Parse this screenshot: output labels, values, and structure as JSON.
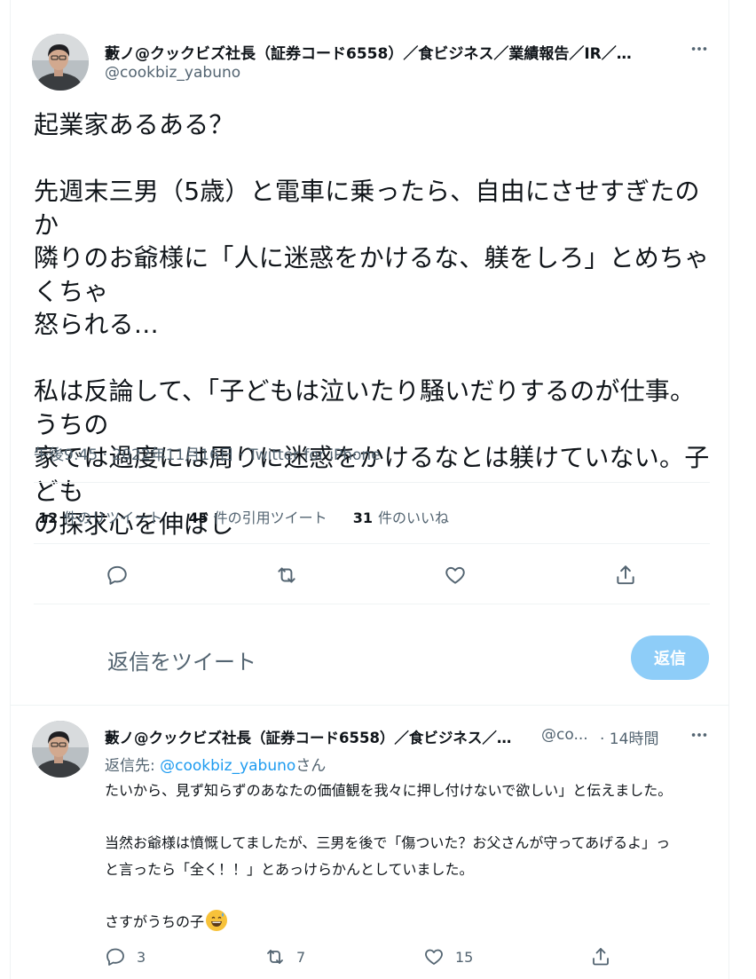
{
  "main_tweet": {
    "author_name": "藪ノ@クックビズ社長（証券コード6558）／食ビジネス／業績報告／IR／…",
    "handle": "@cookbiz_yabuno",
    "text": "起業家あるある？\n\n先週末三男（5歳）と電車に乗ったら、自由にさせすぎたのか\n隣りのお爺様に「人に迷惑をかけるな、躾をしろ」とめちゃくちゃ\n怒られる…\n\n私は反論して、「子どもは泣いたり騒いだりするのが仕事。うちの\n家では過度には周りに迷惑をかけるなとは躾けていない。子ども\nの探求心を伸ばし",
    "timestamp": "午後9:45 · 2022年11月16日 · Twitter for iPhone",
    "stats": {
      "retweets_count": "12",
      "retweets_label": "件のリツイート",
      "quotes_count": "45",
      "quotes_label": "件の引用ツイート",
      "likes_count": "31",
      "likes_label": "件のいいね"
    },
    "actions": [
      "reply-icon",
      "retweet-icon",
      "like-icon",
      "share-icon"
    ]
  },
  "compose": {
    "placeholder": "返信をツイート",
    "button_label": "返信"
  },
  "reply_tweet": {
    "author_name": "藪ノ@クックビズ社長（証券コード6558）／食ビジネス／…",
    "handle": "@co...",
    "time": "· 14時間",
    "reply_to_prefix": "返信先: ",
    "reply_to_handle": "@cookbiz_yabuno",
    "reply_to_suffix": "さん",
    "text": "たいから、見ず知らずのあなたの価値観を我々に押し付けないで欲しい」と伝えました。\n\n当然お爺様は憤慨してましたが、三男を後で「傷ついた？お父さんが守ってあげるよ」っ\nと言ったら「全く！！」とあっけらかんとしていました。\n\nさすがうちの子",
    "emoji": "grinning-sweat-emoji",
    "counts": {
      "replies": "3",
      "retweets": "7",
      "likes": "15"
    }
  },
  "colors": {
    "accent": "#1d9bf0",
    "button_disabled": "#8ecdf8",
    "secondary_text": "#536471"
  }
}
